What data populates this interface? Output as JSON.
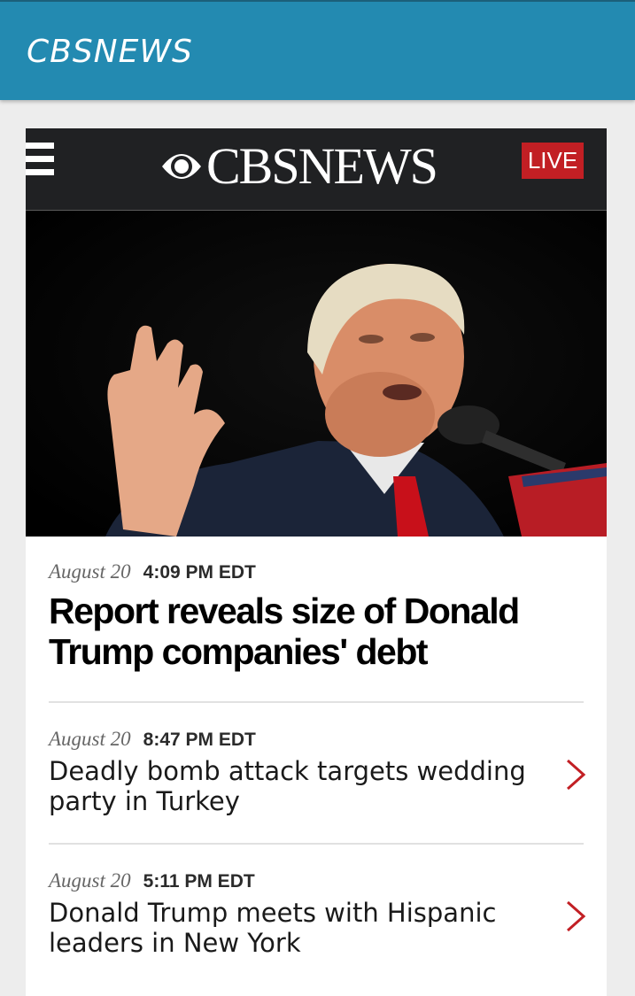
{
  "app": {
    "title": "CBSNEWS"
  },
  "site_header": {
    "logo_text": "CBSNEWS",
    "live_label": "LIVE"
  },
  "lead_story": {
    "date": "August 20",
    "time": "4:09 PM EDT",
    "headline": "Report reveals size of Donald Trump companies' debt"
  },
  "stories": [
    {
      "date": "August 20",
      "time": "8:47 PM EDT",
      "title": "Deadly bomb attack targets wedding party in Turkey"
    },
    {
      "date": "August 20",
      "time": "5:11 PM EDT",
      "title": "Donald Trump meets with Hispanic leaders in New York"
    }
  ],
  "colors": {
    "app_bar": "#238ab1",
    "site_header": "#202123",
    "live": "#c21f24",
    "chevron": "#c21f24"
  },
  "icons": {
    "menu": "hamburger-icon",
    "logo": "cbs-eye-icon",
    "row_arrow": "chevron-right-icon"
  }
}
